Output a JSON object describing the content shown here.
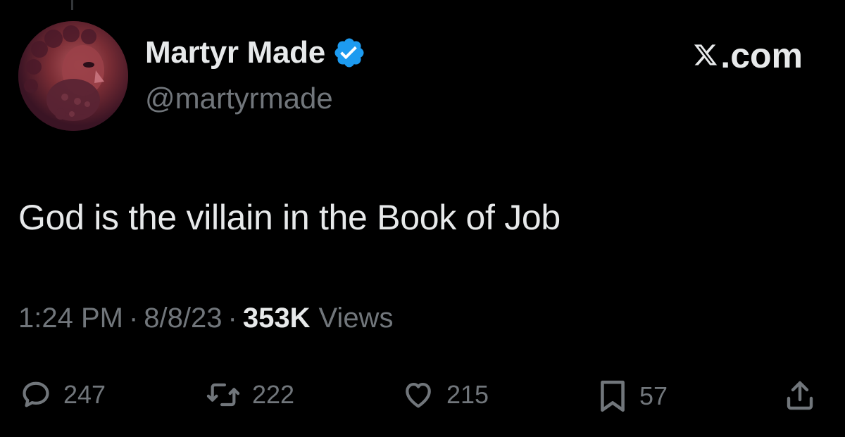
{
  "tweet": {
    "display_name": "Martyr Made",
    "handle": "@martyrmade",
    "site_label": "X.com",
    "text": "God is the villain in the Book of Job",
    "time": "1:24 PM",
    "date": "8/8/23",
    "separator": "·",
    "views_count": "353K",
    "views_label": "Views"
  },
  "actions": {
    "replies": "247",
    "reposts": "222",
    "likes": "215",
    "bookmarks": "57"
  },
  "icons": {
    "verified": "verified-badge-icon",
    "reply": "reply-icon",
    "repost": "repost-icon",
    "like": "heart-icon",
    "bookmark": "bookmark-icon",
    "share": "share-icon"
  },
  "colors": {
    "background": "#000000",
    "text_primary": "#e7e9ea",
    "text_secondary": "#71767b",
    "verified_blue": "#1d9bf0"
  }
}
